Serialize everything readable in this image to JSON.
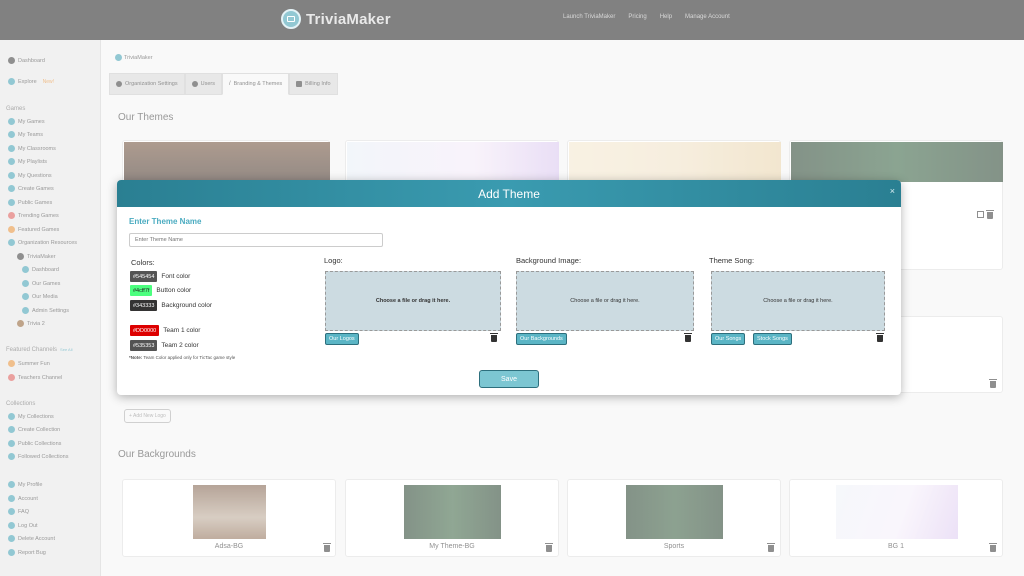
{
  "app": {
    "brand": "TriviaMaker"
  },
  "topnav": [
    "Launch TriviaMaker",
    "Pricing",
    "Help",
    "Manage Account"
  ],
  "sidebar": {
    "dashboard": "Dashboard",
    "explore": "Explore",
    "explore_badge": "New!",
    "games_head": "Games",
    "games": [
      "My Games",
      "My Teams",
      "My Classrooms",
      "My Playlists",
      "My Questions",
      "Create Games",
      "Public Games",
      "Trending Games",
      "Featured Games",
      "Organization Resources"
    ],
    "org": "TriviaMaker",
    "org_items": [
      "Dashboard",
      "Our Games",
      "Our Media",
      "Admin Settings"
    ],
    "trivia2": "Trivia 2",
    "channels_head": "Featured Channels",
    "channels_see_all": "See All",
    "channels": [
      "Summer Fun",
      "Teachers Channel"
    ],
    "collections_head": "Collections",
    "collections": [
      "My Collections",
      "Create Collection",
      "Public Collections",
      "Followed Collections"
    ],
    "account": [
      "My Profile",
      "Account",
      "FAQ",
      "Log Out",
      "Delete Account",
      "Report Bug"
    ]
  },
  "main": {
    "breadcrumb": "TriviaMaker",
    "tabs": [
      "Organization Settings",
      "Users",
      "Branding & Themes",
      "Billing Info"
    ],
    "themes_title": "Our Themes",
    "add_logo": "+ Add New Logo",
    "backgrounds_title": "Our Backgrounds",
    "backgrounds": [
      "Adsa-BG",
      "My Theme-BG",
      "Sports",
      "BG 1"
    ]
  },
  "modal": {
    "title": "Add Theme",
    "close": "×",
    "name_label": "Enter Theme Name",
    "name_placeholder": "Enter Theme Name",
    "colors_label": "Colors:",
    "colors": [
      {
        "hex": "#545454",
        "label": "Font color"
      },
      {
        "hex": "#4cff7f",
        "label": "Button color"
      },
      {
        "hex": "#343333",
        "label": "Background color"
      }
    ],
    "team_colors": [
      {
        "hex": "#DD0000",
        "label": "Team 1 color"
      },
      {
        "hex": "#535353",
        "label": "Team 2 color"
      }
    ],
    "note_bold": "*Note:",
    "note_text": " Team Color applied only for TicTac game style",
    "logo_label": "Logo:",
    "logo_drop": "Choose a file or drag it here.",
    "logo_btn": "Our Logos",
    "bg_label": "Background Image:",
    "bg_drop": "Choose a file or drag it here.",
    "bg_btn": "Our Backgrounds",
    "song_label": "Theme Song:",
    "song_drop": "Choose a file or drag it here.",
    "song_btn1": "Our Songs",
    "song_btn2": "Stock Songs",
    "save": "Save"
  }
}
